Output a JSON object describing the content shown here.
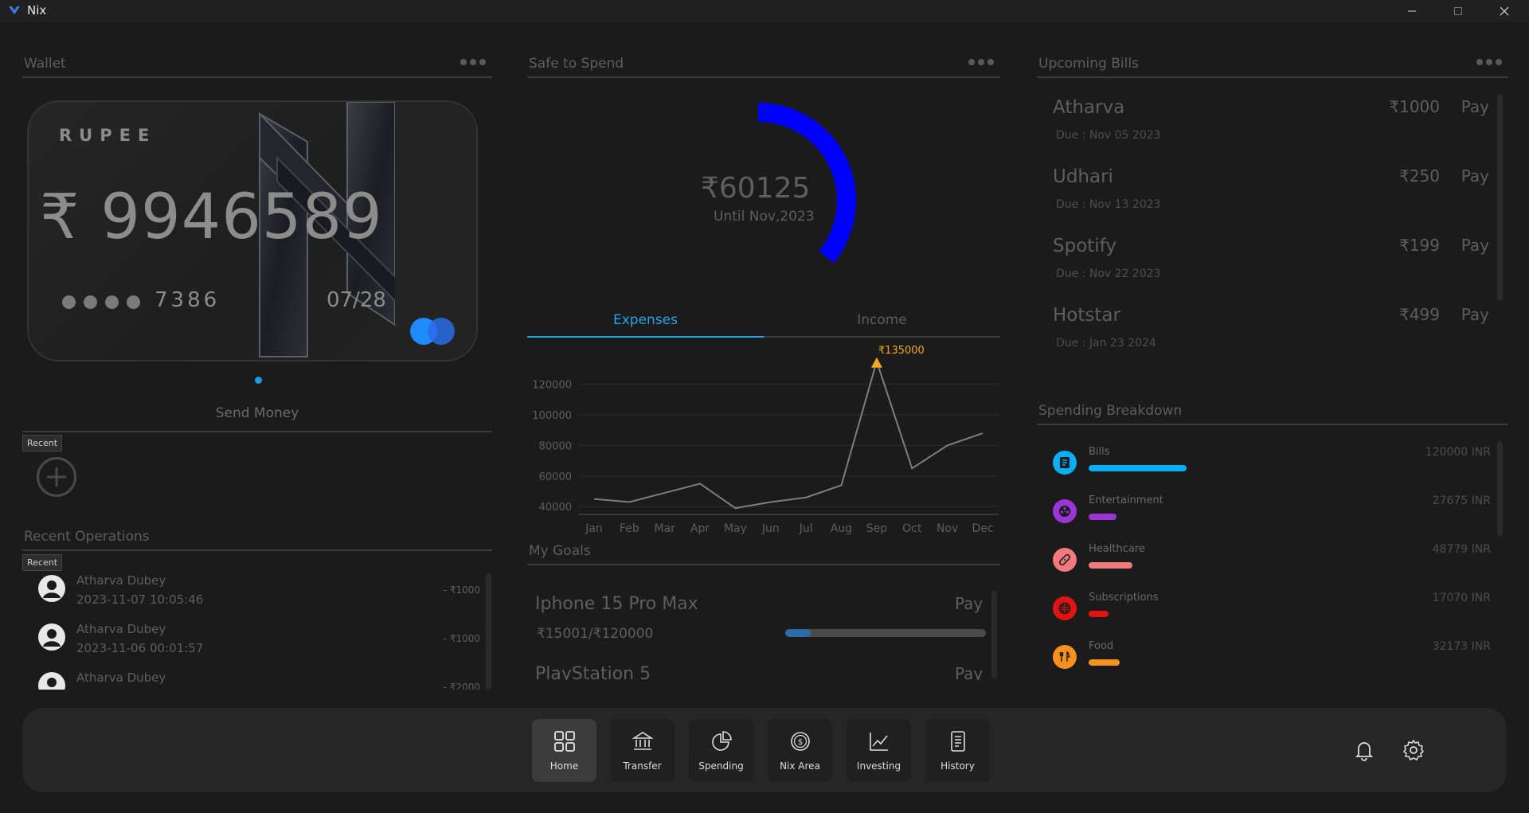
{
  "window": {
    "title": "Nix"
  },
  "wallet": {
    "section_title": "Wallet",
    "card": {
      "currency": "RUPEE",
      "balance": "₹ 9946589",
      "last4": "7386",
      "expiry": "07/28"
    },
    "send_money_label": "Send Money",
    "recent_tooltip": "Recent"
  },
  "recent_operations": {
    "section_title": "Recent Operations",
    "tooltip": "Recent",
    "items": [
      {
        "name": "Atharva Dubey",
        "time": "2023-11-07 10:05:46",
        "amount": "- ₹1000"
      },
      {
        "name": "Atharva Dubey",
        "time": "2023-11-06 00:01:57",
        "amount": "- ₹1000"
      },
      {
        "name": "Atharva Dubey",
        "time": "",
        "amount": "- ₹2000"
      }
    ]
  },
  "safe_to_spend": {
    "section_title": "Safe to Spend",
    "amount": "₹60125",
    "until": "Until Nov,2023",
    "ring_fraction": 0.36,
    "ring_color": "#0000ff"
  },
  "tabs": [
    {
      "label": "Expenses",
      "active": true
    },
    {
      "label": "Income",
      "active": false
    }
  ],
  "chart_data": {
    "type": "line",
    "categories": [
      "Jan",
      "Feb",
      "Mar",
      "Apr",
      "May",
      "Jun",
      "Jul",
      "Aug",
      "Sep",
      "Oct",
      "Nov",
      "Dec"
    ],
    "series": [
      {
        "values": [
          45000,
          43000,
          49000,
          55000,
          39000,
          43000,
          46000,
          54000,
          135000,
          65000,
          80000,
          88000
        ]
      }
    ],
    "yticks": [
      40000,
      60000,
      80000,
      100000,
      120000
    ],
    "ylim": [
      37000,
      138000
    ],
    "annotation": {
      "category": "Sep",
      "label": "₹135000",
      "color": "#f5a623"
    },
    "grid": true
  },
  "goals": {
    "section_title": "My Goals",
    "items": [
      {
        "name": "Iphone 15 Pro Max",
        "pay_label": "Pay",
        "progress_text": "₹15001/₹120000",
        "progress": 0.125
      },
      {
        "name": "PlayStation 5",
        "pay_label": "Pay"
      }
    ]
  },
  "bills": {
    "section_title": "Upcoming Bills",
    "items": [
      {
        "name": "Atharva",
        "due": "Due : Nov 05 2023",
        "amount": "₹1000",
        "pay_label": "Pay"
      },
      {
        "name": "Udhari",
        "due": "Due : Nov 13 2023",
        "amount": "₹250",
        "pay_label": "Pay"
      },
      {
        "name": "Spotify",
        "due": "Due : Nov 22 2023",
        "amount": "₹199",
        "pay_label": "Pay"
      },
      {
        "name": "Hotstar",
        "due": "Due : Jan 23 2024",
        "amount": "₹499",
        "pay_label": "Pay"
      }
    ]
  },
  "spending": {
    "section_title": "Spending Breakdown",
    "items": [
      {
        "label": "Bills",
        "amount": "120000 INR",
        "fraction": 0.3,
        "color": "#0aaef5",
        "icon": "document-icon"
      },
      {
        "label": "Entertainment",
        "amount": "27675 INR",
        "fraction": 0.085,
        "color": "#9b35d4",
        "icon": "film-reel-icon"
      },
      {
        "label": "Healthcare",
        "amount": "48779 INR",
        "fraction": 0.135,
        "color": "#f07a7e",
        "icon": "bandage-icon"
      },
      {
        "label": "Subscriptions",
        "amount": "17070 INR",
        "fraction": 0.06,
        "color": "#e01414",
        "icon": "globe-icon"
      },
      {
        "label": "Food",
        "amount": "32173 INR",
        "fraction": 0.095,
        "color": "#f5911f",
        "icon": "food-icon"
      }
    ]
  },
  "nav": {
    "items": [
      {
        "label": "Home",
        "active": true
      },
      {
        "label": "Transfer",
        "active": false
      },
      {
        "label": "Spending",
        "active": false
      },
      {
        "label": "Nix Area",
        "active": false
      },
      {
        "label": "Investing",
        "active": false
      },
      {
        "label": "History",
        "active": false
      }
    ]
  }
}
